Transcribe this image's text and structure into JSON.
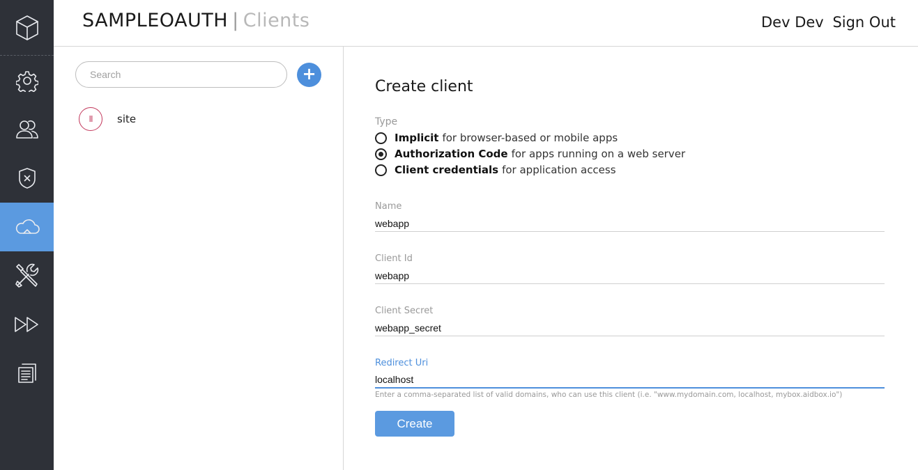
{
  "header": {
    "app_name": "SAMPLEOAUTH",
    "separator": "|",
    "page_name": "Clients",
    "user_first": "Dev",
    "user_last": "Dev",
    "signout_label": "Sign Out"
  },
  "sidebar": {
    "logo_icon": "cube-icon",
    "items": [
      {
        "icon": "gear-icon",
        "active": false
      },
      {
        "icon": "users-icon",
        "active": false
      },
      {
        "icon": "shield-icon",
        "active": false
      },
      {
        "icon": "cloud-icon",
        "active": true
      },
      {
        "icon": "tools-icon",
        "active": false
      },
      {
        "icon": "fast-forward-icon",
        "active": false
      },
      {
        "icon": "documents-icon",
        "active": false
      }
    ],
    "colors": {
      "background": "#2e3138",
      "active": "#5b9ae0"
    }
  },
  "client_list": {
    "search_placeholder": "Search",
    "add_label": "+",
    "clients": [
      {
        "initials": "II",
        "name": "site"
      }
    ]
  },
  "form": {
    "title": "Create client",
    "type_label": "Type",
    "types": [
      {
        "name": "Implicit",
        "description": "for browser-based or mobile apps",
        "selected": false
      },
      {
        "name": "Authorization Code",
        "description": "for apps running on a web server",
        "selected": true
      },
      {
        "name": "Client credentials",
        "description": "for application access",
        "selected": false
      }
    ],
    "name": {
      "label": "Name",
      "value": "webapp"
    },
    "client_id": {
      "label": "Client Id",
      "value": "webapp"
    },
    "client_secret": {
      "label": "Client Secret",
      "value": "webapp_secret"
    },
    "redirect_uri": {
      "label": "Redirect Uri",
      "value": "localhost"
    },
    "redirect_hint": "Enter a comma-separated list of valid domains, who can use this client (i.e. \"www.mydomain.com, localhost, mybox.aidbox.io\")",
    "submit_label": "Create",
    "accent_color": "#4d8fdc"
  }
}
